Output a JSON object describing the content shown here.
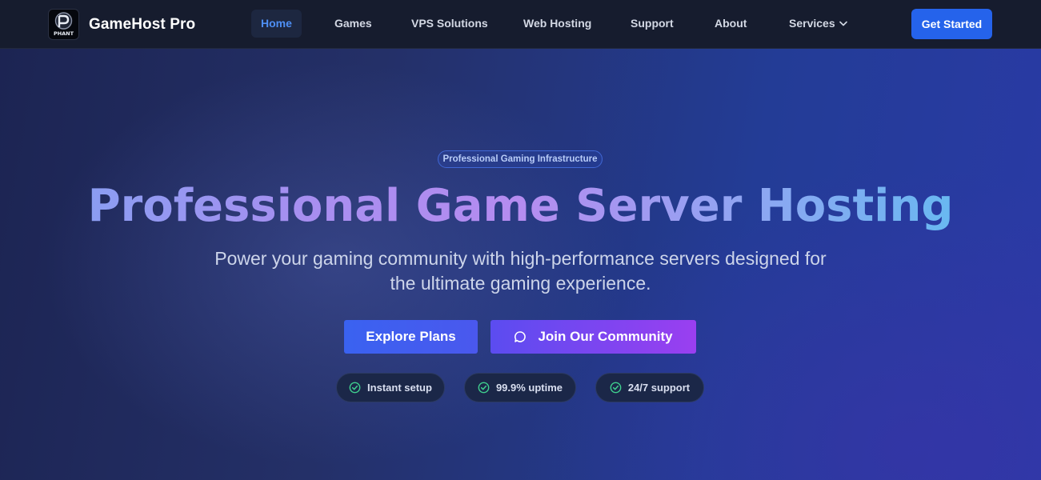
{
  "brand": {
    "name": "GameHost Pro",
    "logo_text": "PHANT"
  },
  "nav": {
    "items": [
      {
        "label": "Home",
        "active": true
      },
      {
        "label": "Games"
      },
      {
        "label": "VPS Solutions"
      },
      {
        "label": "Web Hosting"
      },
      {
        "label": "Support"
      },
      {
        "label": "About"
      },
      {
        "label": "Services",
        "dropdown": true
      }
    ],
    "cta_label": "Get Started"
  },
  "hero": {
    "badge": "Professional Gaming Infrastructure",
    "title": "Professional Game Server Hosting",
    "subtitle": "Power your gaming community with high-performance servers designed for the ultimate gaming experience.",
    "primary_cta": "Explore Plans",
    "secondary_cta": "Join Our Community",
    "features": [
      "Instant setup",
      "99.9% uptime",
      "24/7 support"
    ]
  },
  "colors": {
    "nav_bg": "#161c2e",
    "accent": "#2563eb",
    "active_link": "#4e8ff5",
    "check": "#3fcf8e"
  },
  "icons": {
    "dropdown": "chevron-down-icon",
    "community": "chat-bubble-icon",
    "feature": "check-circle-icon"
  }
}
